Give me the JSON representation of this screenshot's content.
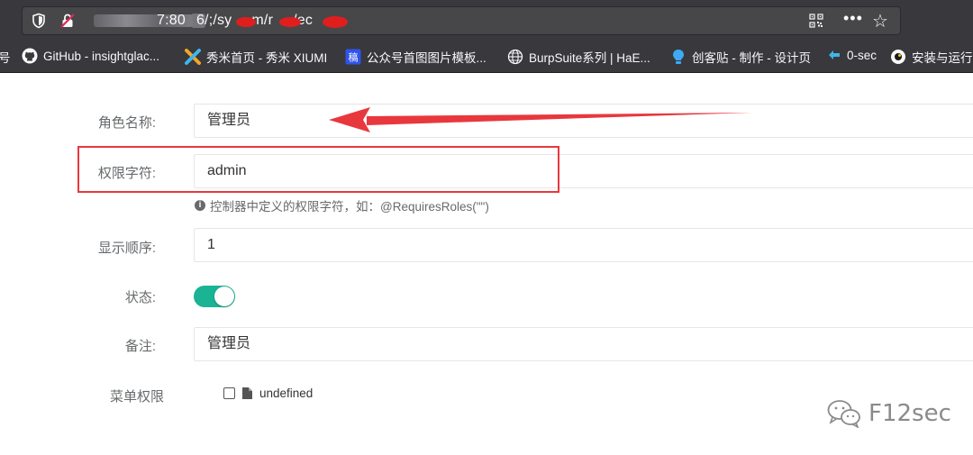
{
  "browser": {
    "url_visible_start": "7:80",
    "url_visible_mid": "6/;/sy",
    "url_visible_tail1": "m/r",
    "url_visible_tail2": "/ec",
    "menu_glyph": "•••",
    "star_glyph": "☆"
  },
  "bookmarks": [
    {
      "label": "号",
      "icon": "bookmark-icon"
    },
    {
      "label": "GitHub - insightglac...",
      "icon": "github-icon"
    },
    {
      "label": "秀米首页 - 秀米 XIUMI",
      "icon": "xiumi-icon"
    },
    {
      "label": "公众号首图图片模板...",
      "icon": "gaoding-icon"
    },
    {
      "label": "BurpSuite系列 | HaE...",
      "icon": "globe-icon"
    },
    {
      "label": "创客贴 - 制作 - 设计页",
      "icon": "chuangketie-icon"
    },
    {
      "label": "0-sec",
      "icon": "0sec-icon"
    },
    {
      "label": "安装与运行",
      "icon": "docs-icon"
    }
  ],
  "form": {
    "role_name_label": "角色名称:",
    "role_name_value": "管理员",
    "role_key_label": "权限字符:",
    "role_key_value": "admin",
    "role_key_hint": "控制器中定义的权限字符，如：@RequiresRoles(\"\")",
    "sort_label": "显示顺序:",
    "sort_value": "1",
    "status_label": "状态:",
    "status_on": true,
    "remark_label": "备注:",
    "remark_value": "管理员",
    "menu_label": "菜单权限",
    "menu_tree_item": "undefined"
  },
  "watermark": {
    "text": "F12sec"
  },
  "colors": {
    "toolbar": "#38383d",
    "accent_toggle": "#1ab394",
    "annotation_red": "#e8383d"
  }
}
